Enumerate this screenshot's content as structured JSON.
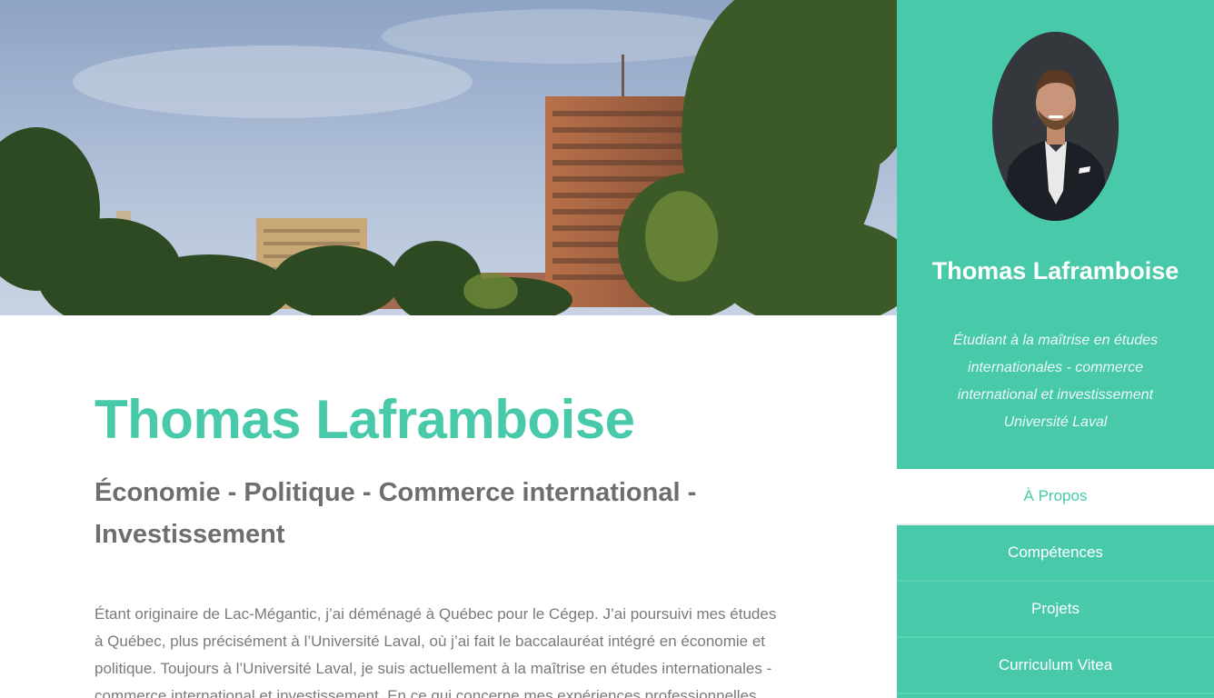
{
  "hero": {
    "alt": "Vue du centre-ville de Québec entre les arbres"
  },
  "main": {
    "title": "Thomas Laframboise",
    "subtitle": "Économie - Politique - Commerce international - Investissement",
    "bio": "Étant originaire de Lac-Mégantic, j’ai déménagé à Québec pour le Cégep. J’ai poursuivi mes études à Québec, plus précisément à l’Université Laval, où j’ai fait le baccalauréat intégré en économie et politique. Toujours à l’Université Laval, je suis actuellement à la maîtrise en études internationales - commerce international et investissement. En ce qui concerne mes expériences professionnelles"
  },
  "sidebar": {
    "name": "Thomas Laframboise",
    "tagline_line1": "Étudiant à la maîtrise en études internationales - commerce international et investissement",
    "tagline_line2": "Université Laval",
    "nav": [
      {
        "label": "À Propos",
        "active": true
      },
      {
        "label": "Compétences",
        "active": false
      },
      {
        "label": "Projets",
        "active": false
      },
      {
        "label": "Curriculum Vitea",
        "active": false
      }
    ]
  },
  "colors": {
    "accent": "#48c9a9",
    "subtitle": "#6e6e6e",
    "body_text": "#7a7a7a"
  }
}
